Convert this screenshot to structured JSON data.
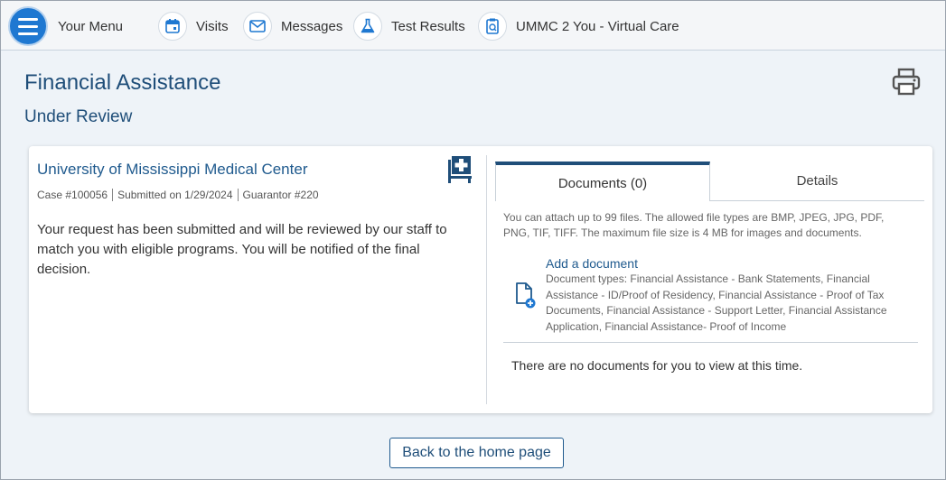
{
  "nav": {
    "menu_label": "Your Menu",
    "items": [
      {
        "label": "Visits",
        "icon": "calendar-icon"
      },
      {
        "label": "Messages",
        "icon": "envelope-icon"
      },
      {
        "label": "Test Results",
        "icon": "flask-icon"
      },
      {
        "label": "UMMC 2 You - Virtual Care",
        "icon": "virtual-care-icon"
      }
    ]
  },
  "page": {
    "title": "Financial Assistance",
    "status": "Under Review"
  },
  "card": {
    "org_name": "University of Mississippi Medical Center",
    "case": "Case #100056",
    "submitted": "Submitted on 1/29/2024",
    "guarantor": "Guarantor #220",
    "message": "Your request has been submitted and will be reviewed by our staff to match you with eligible programs. You will be notified of the final decision."
  },
  "tabs": {
    "documents": "Documents (0)",
    "details": "Details"
  },
  "documents": {
    "info": "You can attach up to 99 files. The allowed file types are BMP, JPEG, JPG, PDF, PNG, TIF, TIFF. The maximum file size is 4 MB for images and documents.",
    "add_label": "Add a document",
    "types": "Document types: Financial Assistance - Bank Statements, Financial Assistance - ID/Proof of Residency, Financial Assistance - Proof of Tax Documents, Financial Assistance - Support Letter, Financial Assistance Application, Financial Assistance- Proof of Income",
    "empty": "There are no documents for you to view at this time."
  },
  "back_button": "Back to the home page",
  "colors": {
    "accent": "#1f78d1",
    "heading": "#1f4e79",
    "link": "#1f5a8e"
  }
}
